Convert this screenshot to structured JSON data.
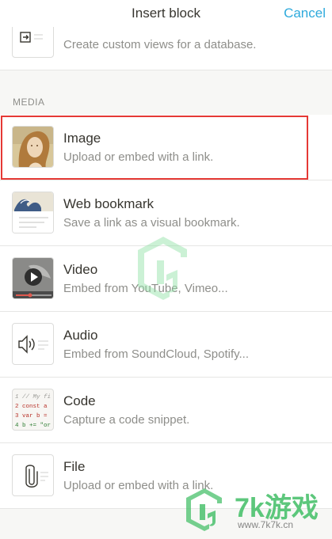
{
  "header": {
    "title": "Insert block",
    "cancel_label": "Cancel"
  },
  "top_partial": {
    "desc": "Create custom views for a database."
  },
  "media_section": {
    "label": "MEDIA"
  },
  "items": [
    {
      "title": "Image",
      "desc": "Upload or embed with a link."
    },
    {
      "title": "Web bookmark",
      "desc": "Save a link as a visual bookmark."
    },
    {
      "title": "Video",
      "desc": "Embed from YouTube, Vimeo..."
    },
    {
      "title": "Audio",
      "desc": "Embed from SoundCloud, Spotify..."
    },
    {
      "title": "Code",
      "desc": "Capture a code snippet."
    },
    {
      "title": "File",
      "desc": "Upload or embed with a link."
    }
  ],
  "code_thumb": {
    "line1": "1 // My fi",
    "line2": "2 const a",
    "line3": "3 var b =",
    "line4": "4 b += \"or"
  },
  "watermark": {
    "brand": "7k游戏",
    "url": "www.7k7k.cn"
  },
  "colors": {
    "accent": "#2eaadc",
    "selection": "#e53935",
    "text": "#37352f",
    "muted": "#8e8e8a"
  }
}
